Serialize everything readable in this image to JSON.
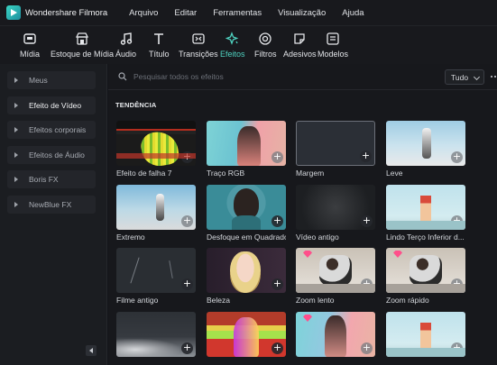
{
  "app": {
    "name": "Wondershare Filmora"
  },
  "menu": [
    "Arquivo",
    "Editar",
    "Ferramentas",
    "Visualização",
    "Ajuda"
  ],
  "toolbar": [
    {
      "label": "Mídia",
      "icon": "media-icon"
    },
    {
      "label": "Estoque de Mídia",
      "icon": "stock-media-icon"
    },
    {
      "label": "Áudio",
      "icon": "music-note-icon"
    },
    {
      "label": "Título",
      "icon": "title-t-icon"
    },
    {
      "label": "Transições",
      "icon": "transitions-icon"
    },
    {
      "label": "Efeitos",
      "icon": "effects-sparkle-icon",
      "active": true
    },
    {
      "label": "Filtros",
      "icon": "filters-icon"
    },
    {
      "label": "Adesivos",
      "icon": "stickers-icon"
    },
    {
      "label": "Modelos",
      "icon": "templates-icon"
    }
  ],
  "sidebar": {
    "items": [
      {
        "label": "Meus"
      },
      {
        "label": "Efeito de Vídeo",
        "active": true
      },
      {
        "label": "Efeitos corporais"
      },
      {
        "label": "Efeitos de Áudio"
      },
      {
        "label": "Boris FX"
      },
      {
        "label": "NewBlue FX"
      }
    ]
  },
  "search": {
    "placeholder": "Pesquisar todos os efeitos",
    "value": ""
  },
  "filter": {
    "selected": "Tudo"
  },
  "section": {
    "title": "TENDÊNCIA"
  },
  "effects": [
    {
      "label": "Efeito de falha 7"
    },
    {
      "label": "Traço RGB"
    },
    {
      "label": "Margem"
    },
    {
      "label": "Leve"
    },
    {
      "label": "Extremo"
    },
    {
      "label": "Desfoque em Quadrado"
    },
    {
      "label": "Vídeo antigo"
    },
    {
      "label": "Lindo Terço Inferior d..."
    },
    {
      "label": "Filme antigo"
    },
    {
      "label": "Beleza"
    },
    {
      "label": "Zoom lento"
    },
    {
      "label": "Zoom rápido"
    },
    {
      "label": ""
    },
    {
      "label": ""
    },
    {
      "label": ""
    },
    {
      "label": ""
    }
  ],
  "colors": {
    "accent": "#4fd3c1",
    "premium": "#ff4f8b",
    "background": "#131519"
  }
}
